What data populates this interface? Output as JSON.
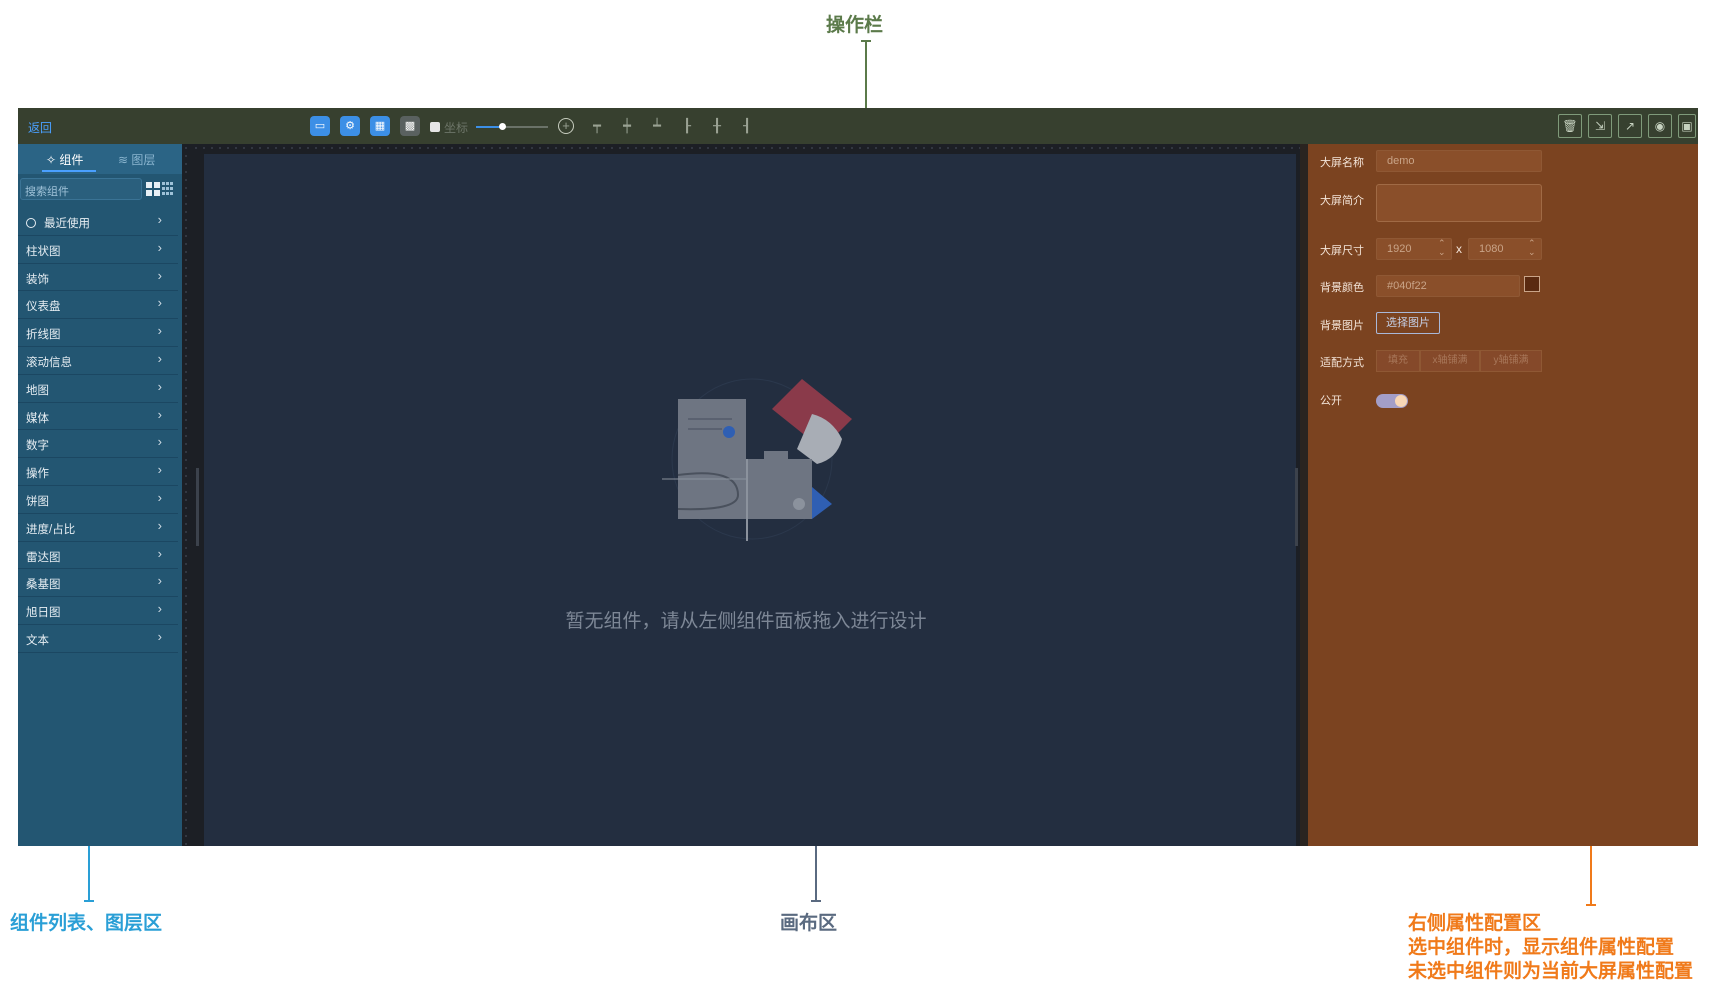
{
  "annotations": {
    "top": "操作栏",
    "left": "组件列表、图层区",
    "center": "画布区",
    "right_line1": "右侧属性配置区",
    "right_line2": "选中组件时，显示组件属性配置",
    "right_line3": "未选中组件则为当前大屏属性配置"
  },
  "toolbar": {
    "back_label": "返回",
    "coordinate_label": "坐标",
    "left_tools": [
      "layout-icon",
      "settings-icon",
      "calendar-icon",
      "grid-icon"
    ],
    "align_tools": [
      "align-top-icon",
      "align-vcenter-icon",
      "align-bottom-icon",
      "align-left-icon",
      "align-hcenter-icon",
      "align-right-icon"
    ],
    "right_tools": [
      "delete-icon",
      "export-icon",
      "share-icon",
      "preview-icon",
      "save-icon"
    ]
  },
  "left_panel": {
    "tabs": [
      {
        "label": "组件",
        "icon": "component-icon"
      },
      {
        "label": "图层",
        "icon": "layers-icon"
      }
    ],
    "search_placeholder": "搜索组件",
    "categories": [
      {
        "label": "最近使用"
      },
      {
        "label": "柱状图"
      },
      {
        "label": "装饰"
      },
      {
        "label": "仪表盘"
      },
      {
        "label": "折线图"
      },
      {
        "label": "滚动信息"
      },
      {
        "label": "地图"
      },
      {
        "label": "媒体"
      },
      {
        "label": "数字"
      },
      {
        "label": "操作"
      },
      {
        "label": "饼图"
      },
      {
        "label": "进度/占比"
      },
      {
        "label": "雷达图"
      },
      {
        "label": "桑基图"
      },
      {
        "label": "旭日图"
      },
      {
        "label": "文本"
      }
    ]
  },
  "canvas": {
    "empty_message": "暂无组件，请从左侧组件面板拖入进行设计"
  },
  "properties": {
    "name_label": "大屏名称",
    "name_value": "demo",
    "intro_label": "大屏简介",
    "size_label": "大屏尺寸",
    "width_value": "1920",
    "size_separator": "x",
    "height_value": "1080",
    "bg_color_label": "背景颜色",
    "bg_color_value": "#040f22",
    "bg_image_label": "背景图片",
    "choose_image_button": "选择图片",
    "fit_label": "适配方式",
    "fit_options": [
      "填充",
      "x轴铺满",
      "y轴铺满"
    ],
    "public_label": "公开",
    "public_on": true
  },
  "colors": {
    "toolbar_bg": "#37402f",
    "left_panel_bg": "#235672",
    "canvas_bg": "#232e40",
    "right_panel_bg": "#7b4320",
    "accent": "#3c8fe6"
  }
}
